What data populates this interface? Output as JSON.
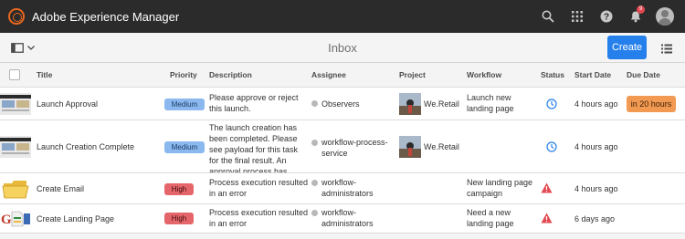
{
  "app": {
    "title": "Adobe Experience Manager",
    "notification_count": "9"
  },
  "toolbar": {
    "page_title": "Inbox",
    "create_label": "Create"
  },
  "columns": {
    "title": "Title",
    "priority": "Priority",
    "description": "Description",
    "assignee": "Assignee",
    "project": "Project",
    "workflow": "Workflow",
    "status": "Status",
    "start_date": "Start Date",
    "due_date": "Due Date"
  },
  "rows": [
    {
      "title": "Launch Approval",
      "priority": "Medium",
      "priority_level": "medium",
      "description": [
        "Please approve or reject",
        "this launch."
      ],
      "assignee": [
        "Observers"
      ],
      "project": "We.Retail",
      "workflow": [
        "Launch new",
        "landing page"
      ],
      "status_icon": "clock-icon",
      "start_date": "4 hours ago",
      "due_date": "in 20 hours"
    },
    {
      "title": "Launch Creation Complete",
      "priority": "Medium",
      "priority_level": "medium",
      "description": [
        "The launch creation has",
        "been completed. Please",
        "see payload for this task",
        "for the final result. An",
        "approval process has"
      ],
      "assignee": [
        "workflow-process-",
        "service"
      ],
      "project": "We.Retail",
      "workflow": [],
      "status_icon": "clock-icon",
      "start_date": "4 hours ago",
      "due_date": ""
    },
    {
      "title": "Create Email",
      "priority": "High",
      "priority_level": "high",
      "description": [
        "Process execution resulted",
        "in an error"
      ],
      "assignee": [
        "workflow-",
        "administrators"
      ],
      "project": "",
      "workflow": [
        "New landing page",
        "campaign"
      ],
      "status_icon": "alert-icon",
      "start_date": "4 hours ago",
      "due_date": ""
    },
    {
      "title": "Create Landing Page",
      "priority": "High",
      "priority_level": "high",
      "description": [
        "Process execution resulted",
        "in an error"
      ],
      "assignee": [
        "workflow-",
        "administrators"
      ],
      "project": "",
      "workflow": [
        "Need a new",
        "landing page"
      ],
      "status_icon": "alert-icon",
      "start_date": "6 days ago",
      "due_date": ""
    }
  ],
  "colors": {
    "topbar": "#2b2b2b",
    "accent": "#2680eb",
    "medium": "#8ab8ef",
    "high": "#e5666a",
    "due": "#f29a52",
    "alert": "#e34850"
  }
}
